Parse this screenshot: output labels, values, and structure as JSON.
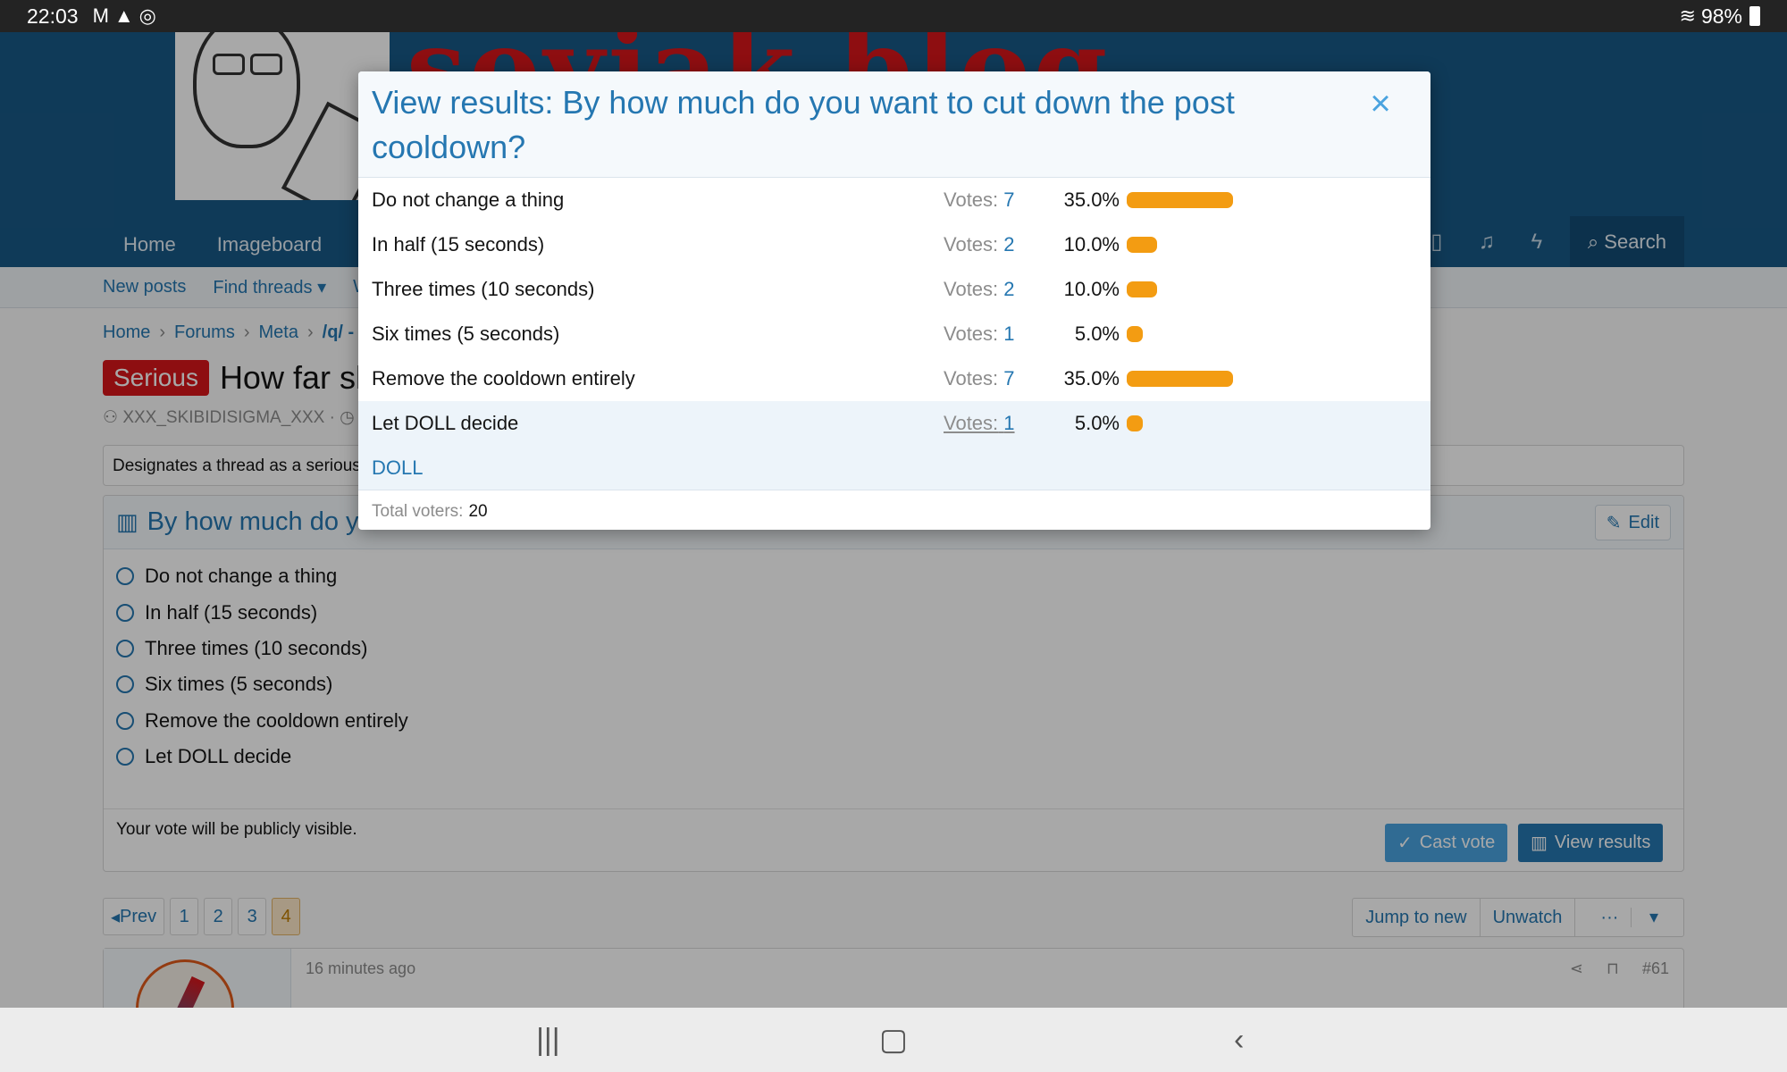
{
  "status_bar": {
    "time": "22:03",
    "battery": "98%",
    "icons": [
      "gmail-icon",
      "alert-icon",
      "sync-icon",
      "wifi-icon",
      "battery-icon"
    ]
  },
  "site": {
    "title": "soyjak.blog",
    "nav": [
      "Home",
      "Imageboard"
    ],
    "search": "Search",
    "subnav": [
      "New posts",
      "Find threads",
      "W"
    ],
    "breadcrumb": [
      "Home",
      "Forums",
      "Meta",
      "/q/ -"
    ]
  },
  "thread": {
    "tag": "Serious",
    "title": "How far sl",
    "author": "XXX_SKIBIDISIGMA_XXX · ◷ T",
    "description": "Designates a thread as a serious"
  },
  "poll": {
    "title": "By how much do y",
    "edit": "Edit",
    "options": [
      "Do not change a thing",
      "In half (15 seconds)",
      "Three times (10 seconds)",
      "Six times (5 seconds)",
      "Remove the cooldown entirely",
      "Let DOLL decide"
    ],
    "note": "Your vote will be publicly visible.",
    "cast_vote": "Cast vote",
    "view_results": "View results"
  },
  "pagination": {
    "prev": "Prev",
    "pages": [
      "1",
      "2",
      "3",
      "4"
    ],
    "current": "4",
    "jump": "Jump to new",
    "unwatch": "Unwatch",
    "more": "···"
  },
  "post": {
    "time": "16 minutes ago",
    "number": "#61"
  },
  "modal": {
    "title": "View results: By how much do you want to cut down the post cooldown?",
    "close": "×",
    "votes_prefix": "Votes:",
    "results": [
      {
        "label": "Do not change a thing",
        "votes": "7",
        "percent": "35.0%",
        "fraction": 0.35
      },
      {
        "label": "In half (15 seconds)",
        "votes": "2",
        "percent": "10.0%",
        "fraction": 0.1
      },
      {
        "label": "Three times (10 seconds)",
        "votes": "2",
        "percent": "10.0%",
        "fraction": 0.1
      },
      {
        "label": "Six times (5 seconds)",
        "votes": "1",
        "percent": "5.0%",
        "fraction": 0.05
      },
      {
        "label": "Remove the cooldown entirely",
        "votes": "7",
        "percent": "35.0%",
        "fraction": 0.35
      },
      {
        "label": "Let DOLL decide",
        "votes": "1",
        "percent": "5.0%",
        "fraction": 0.05
      }
    ],
    "voter_name": "DOLL",
    "total_label": "Total voters:",
    "total_value": "20",
    "bar_color": "#f39c12",
    "accent_color": "#2577b1"
  }
}
